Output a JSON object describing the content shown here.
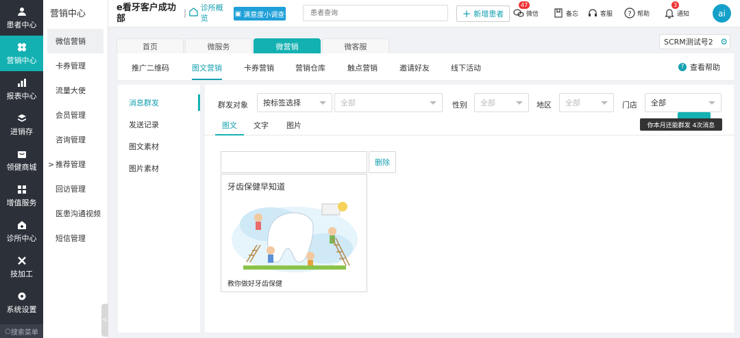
{
  "leftnav": {
    "items": [
      {
        "label": "患者中心",
        "icon": "patient-icon"
      },
      {
        "label": "营销中心",
        "icon": "marketing-icon",
        "active": true
      },
      {
        "label": "报表中心",
        "icon": "report-icon"
      },
      {
        "label": "进销存",
        "icon": "inventory-icon"
      },
      {
        "label": "领健商城",
        "icon": "mall-icon"
      },
      {
        "label": "增值服务",
        "icon": "value-added-icon"
      },
      {
        "label": "诊所中心",
        "icon": "clinic-icon"
      },
      {
        "label": "技加工",
        "icon": "tools-icon"
      },
      {
        "label": "系统设置",
        "icon": "gear-icon"
      }
    ],
    "search_label": "搜索菜单"
  },
  "submenu": {
    "title": "营销中心",
    "items": [
      "微信营销",
      "卡券管理",
      "流量大使",
      "会员管理",
      "咨询管理",
      "推荐管理",
      "回访管理",
      "医患沟通视频",
      "短信管理"
    ]
  },
  "header": {
    "clinic_name": "e看牙客户成功部",
    "overview_label": "诊所概览",
    "survey_label": "满意度小调查",
    "search_placeholder": "患者查询",
    "new_patient_label": "新增患者",
    "tools": [
      {
        "label": "微信",
        "badge": "47"
      },
      {
        "label": "备忘"
      },
      {
        "label": "客服"
      },
      {
        "label": "帮助"
      },
      {
        "label": "通知",
        "badge": "3"
      }
    ],
    "avatar_text": "ai"
  },
  "tabs": {
    "items": [
      "首页",
      "微服务",
      "微营销",
      "微客服"
    ],
    "active_index": 2,
    "account_label": "SCRM测试号2"
  },
  "subtabs": {
    "items": [
      "推广二维码",
      "图文营销",
      "卡券营销",
      "营销仓库",
      "触点营销",
      "邀请好友",
      "线下活动"
    ],
    "active_index": 1,
    "help_label": "查看帮助"
  },
  "leftpanel": {
    "items": [
      "消息群发",
      "发送记录",
      "图文素材",
      "图片素材"
    ],
    "active_index": 0
  },
  "filters": {
    "target_label": "群发对象",
    "target_value": "按标签选择",
    "tag_value": "全部",
    "gender_label": "性别",
    "gender_value": "全部",
    "region_label": "地区",
    "region_value": "全部",
    "store_label": "门店",
    "store_value": "全部"
  },
  "tooltip": "你本月还能群发 4次消息",
  "content_tabs": {
    "items": [
      "图文",
      "文字",
      "图片"
    ],
    "active_index": 0
  },
  "editor": {
    "delete_label": "删除",
    "card_title": "牙齿保健早知道",
    "card_desc": "教你做好牙齿保健"
  },
  "colors": {
    "accent": "#14b1b2",
    "nav_bg": "#2b3039"
  }
}
